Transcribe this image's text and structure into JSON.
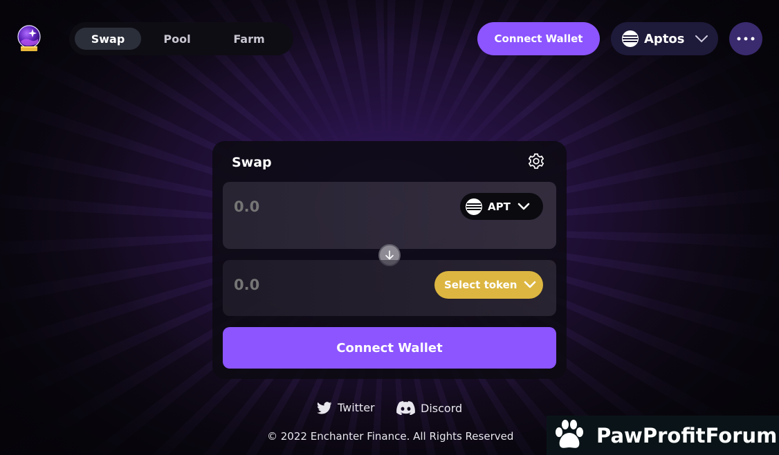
{
  "header": {
    "logo_icon": "crystal-ball-icon",
    "nav": {
      "tabs": [
        {
          "label": "Swap",
          "active": true
        },
        {
          "label": "Pool",
          "active": false
        },
        {
          "label": "Farm",
          "active": false
        }
      ]
    },
    "connect_wallet_label": "Connect Wallet",
    "network": {
      "label": "Aptos",
      "icon": "aptos-icon"
    },
    "more_icon": "more-dots-icon"
  },
  "swap_card": {
    "title": "Swap",
    "from": {
      "amount": "0.0",
      "token_label": "APT"
    },
    "to": {
      "amount": "0.0",
      "token_label": "Select token"
    },
    "connect_wallet_label": "Connect Wallet"
  },
  "footer": {
    "twitter_label": "Twitter",
    "discord_label": "Discord",
    "copyright": "© 2022 Enchanter Finance. All Rights Reserved"
  },
  "watermark": {
    "text": "PawProfitForum"
  },
  "colors": {
    "accent": "#8c55ff",
    "select_token": "#dcb641",
    "network_bg": "#1e1a3a"
  }
}
